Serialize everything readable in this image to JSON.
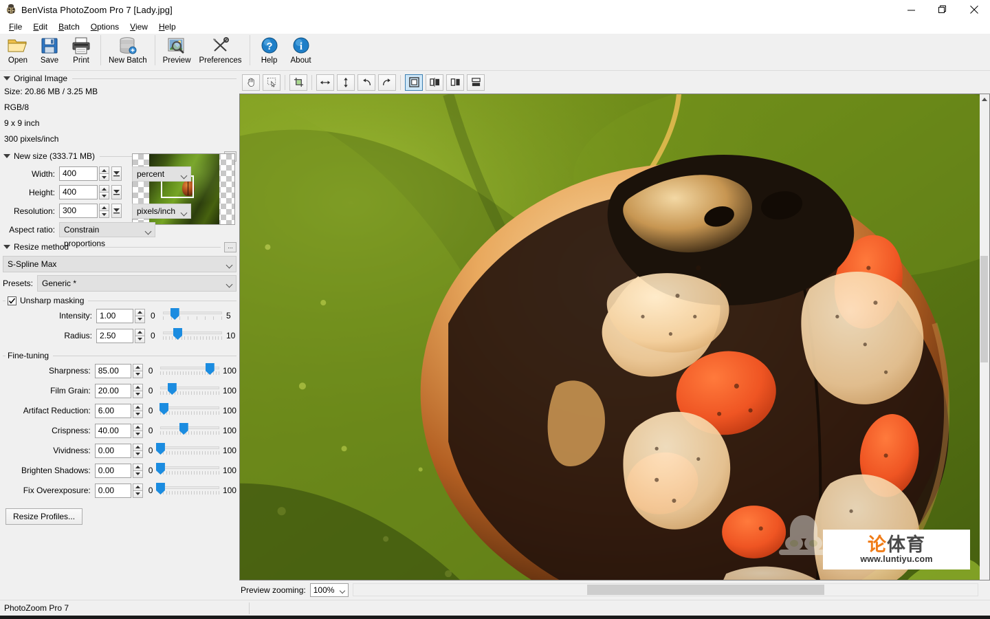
{
  "window": {
    "title": "BenVista PhotoZoom Pro 7  [Lady.jpg]",
    "app_icon": "ladybug-icon",
    "minimize": "—",
    "restore": "❐",
    "close": "✕"
  },
  "menubar": {
    "items": [
      {
        "label": "File",
        "accel": "F"
      },
      {
        "label": "Edit",
        "accel": "E"
      },
      {
        "label": "Batch",
        "accel": "B"
      },
      {
        "label": "Options",
        "accel": "O"
      },
      {
        "label": "View",
        "accel": "V"
      },
      {
        "label": "Help",
        "accel": "H"
      }
    ]
  },
  "toolbar": {
    "buttons": [
      {
        "label": "Open",
        "icon": "folder-open-icon"
      },
      {
        "label": "Save",
        "icon": "floppy-disk-icon"
      },
      {
        "label": "Print",
        "icon": "printer-icon"
      },
      {
        "label": "New Batch",
        "icon": "database-stack-icon"
      },
      {
        "label": "Preview",
        "icon": "image-magnifier-icon"
      },
      {
        "label": "Preferences",
        "icon": "tools-wrench-screwdriver-icon"
      },
      {
        "label": "Help",
        "icon": "question-mark-circle-icon"
      },
      {
        "label": "About",
        "icon": "info-circle-icon"
      }
    ]
  },
  "original_image": {
    "section_title": "Original Image",
    "size": "Size: 20.86 MB / 3.25 MB",
    "color_mode": "RGB/8",
    "dimensions": "9 x 9 inch",
    "resolution": "300 pixels/inch",
    "thumbnail_alt": "ladybug-on-leaf-thumbnail"
  },
  "new_size": {
    "section_title": "New size (333.71 MB)",
    "more_button": "...",
    "width_label": "Width:",
    "width_value": "400",
    "height_label": "Height:",
    "height_value": "400",
    "unit_value": "percent",
    "resolution_label": "Resolution:",
    "resolution_value": "300",
    "resolution_unit": "pixels/inch",
    "aspect_label": "Aspect ratio:",
    "aspect_value": "Constrain proportions"
  },
  "resize_method": {
    "section_title": "Resize method",
    "more_button": "...",
    "method_value": "S-Spline Max",
    "presets_label": "Presets:",
    "presets_value": "Generic *"
  },
  "unsharp": {
    "group_label": "Unsharp masking",
    "checked": true,
    "sliders": [
      {
        "label": "Intensity:",
        "value": "1.00",
        "min": "0",
        "max": "5",
        "pct": 20,
        "ticks": 8
      },
      {
        "label": "Radius:",
        "value": "2.50",
        "min": "0",
        "max": "10",
        "pct": 25,
        "ticks": 20
      }
    ]
  },
  "fine_tuning": {
    "group_label": "Fine-tuning",
    "sliders": [
      {
        "label": "Sharpness:",
        "value": "85.00",
        "min": "0",
        "max": "100",
        "pct": 85,
        "ticks": 22
      },
      {
        "label": "Film Grain:",
        "value": "20.00",
        "min": "0",
        "max": "100",
        "pct": 20,
        "ticks": 22
      },
      {
        "label": "Artifact Reduction:",
        "value": "6.00",
        "min": "0",
        "max": "100",
        "pct": 6,
        "ticks": 22
      },
      {
        "label": "Crispness:",
        "value": "40.00",
        "min": "0",
        "max": "100",
        "pct": 40,
        "ticks": 22
      },
      {
        "label": "Vividness:",
        "value": "0.00",
        "min": "0",
        "max": "100",
        "pct": 0,
        "ticks": 22
      },
      {
        "label": "Brighten Shadows:",
        "value": "0.00",
        "min": "0",
        "max": "100",
        "pct": 0,
        "ticks": 22
      },
      {
        "label": "Fix Overexposure:",
        "value": "0.00",
        "min": "0",
        "max": "100",
        "pct": 0,
        "ticks": 22
      }
    ]
  },
  "resize_profiles_button": "Resize Profiles...",
  "preview_toolbar": {
    "buttons": [
      {
        "name": "hand-pan-icon",
        "active": false
      },
      {
        "name": "selection-marquee-icon",
        "active": false
      },
      {
        "name": "crop-icon",
        "active": false
      },
      {
        "name": "flip-horizontal-icon",
        "active": false
      },
      {
        "name": "flip-vertical-icon",
        "active": false
      },
      {
        "name": "rotate-left-icon",
        "active": false
      },
      {
        "name": "rotate-right-icon",
        "active": false
      },
      {
        "name": "view-single-icon",
        "active": true
      },
      {
        "name": "view-split-vertical-icon",
        "active": false
      },
      {
        "name": "view-side-by-side-icon",
        "active": false
      },
      {
        "name": "view-split-horizontal-icon",
        "active": false
      }
    ]
  },
  "preview": {
    "image_alt": "ladybug-macro-preview",
    "zoom_label": "Preview zooming:",
    "zoom_value": "100%",
    "collapse_arrow": "‹"
  },
  "statusbar": {
    "text": "PhotoZoom Pro 7"
  },
  "watermark": {
    "cn_orange": "论",
    "cn_gray": "体育",
    "url": "www.luntiyu.com"
  },
  "colors": {
    "accent_blue": "#1b8ce0",
    "selected_tool": "#cde6f7",
    "panel_bg": "#f0f0f0",
    "leaf_green": "#6b7d1a",
    "watermark_orange": "#f07c18"
  }
}
